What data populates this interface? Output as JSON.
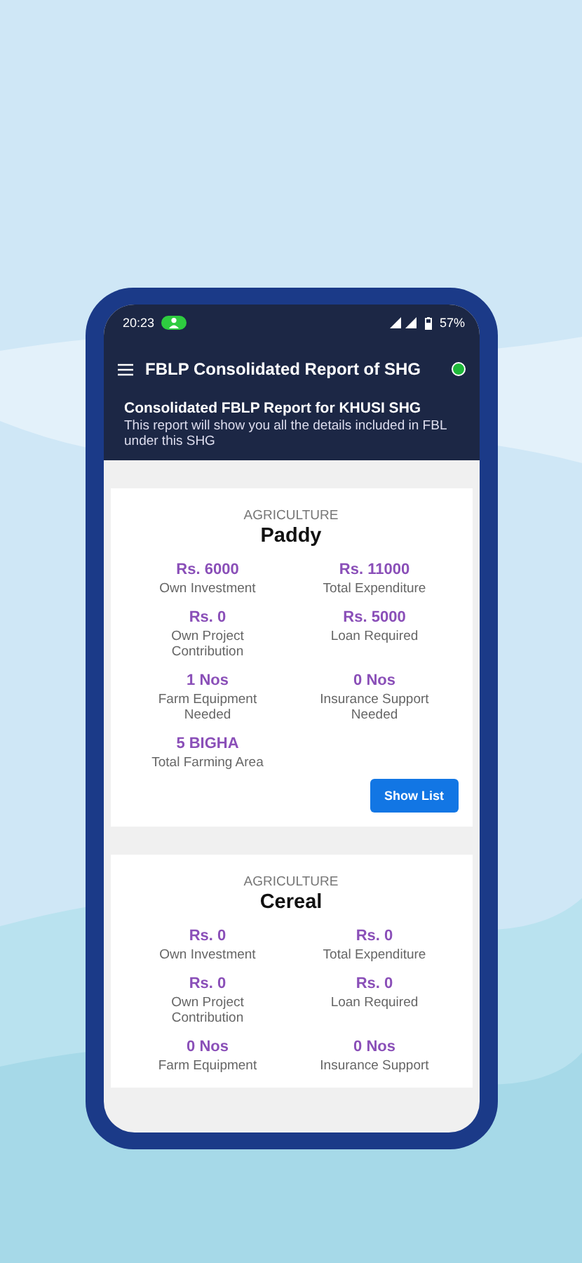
{
  "status_bar": {
    "time": "20:23",
    "battery": "57%"
  },
  "app_bar": {
    "title": "FBLP Consolidated Report of SHG"
  },
  "intro": {
    "heading": "Consolidated FBLP Report for KHUSI SHG",
    "description": "This report will show you all the details included in FBL under this SHG"
  },
  "cards": [
    {
      "category": "AGRICULTURE",
      "name": "Paddy",
      "stats": [
        {
          "value": "Rs. 6000",
          "label": "Own Investment"
        },
        {
          "value": "Rs. 11000",
          "label": "Total Expenditure"
        },
        {
          "value": "Rs. 0",
          "label": "Own Project Contribution"
        },
        {
          "value": "Rs. 5000",
          "label": "Loan Required"
        },
        {
          "value": "1 Nos",
          "label": "Farm Equipment Needed"
        },
        {
          "value": "0 Nos",
          "label": "Insurance Support Needed"
        },
        {
          "value": "5 BIGHA",
          "label": "Total Farming Area"
        }
      ],
      "button": "Show List"
    },
    {
      "category": "AGRICULTURE",
      "name": "Cereal",
      "stats": [
        {
          "value": "Rs. 0",
          "label": "Own Investment"
        },
        {
          "value": "Rs. 0",
          "label": "Total Expenditure"
        },
        {
          "value": "Rs. 0",
          "label": "Own Project Contribution"
        },
        {
          "value": "Rs. 0",
          "label": "Loan Required"
        },
        {
          "value": "0 Nos",
          "label": "Farm Equipment"
        },
        {
          "value": "0 Nos",
          "label": "Insurance Support"
        }
      ]
    }
  ]
}
